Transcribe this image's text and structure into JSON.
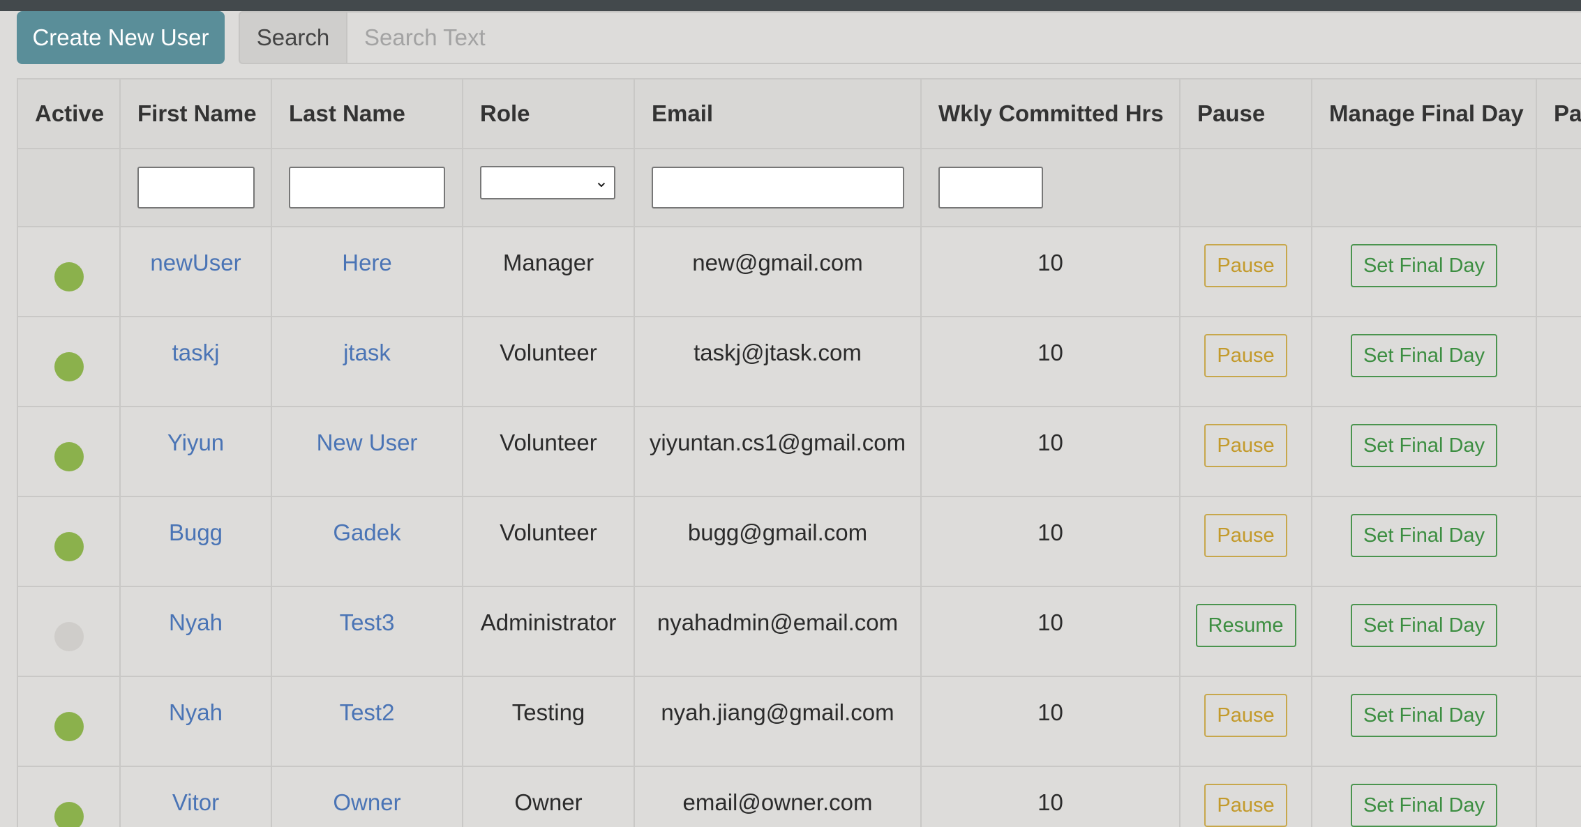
{
  "toolbar": {
    "create_label": "Create New User",
    "search_label": "Search",
    "search_placeholder": "Search Text"
  },
  "colors": {
    "active": "#8bb14c",
    "inactive": "#cfcdca",
    "create_button": "#5a8e99",
    "pause_text": "#c39a2b",
    "success_text": "#3c8e41",
    "link": "#4a74b5"
  },
  "columns": [
    "Active",
    "First Name",
    "Last Name",
    "Role",
    "Email",
    "Wkly Committed Hrs",
    "Pause",
    "Manage Final Day",
    "Pa"
  ],
  "rows": [
    {
      "active": true,
      "first": "newUser",
      "last": "Here",
      "role": "Manager",
      "email": "new@gmail.com",
      "hrs": "10",
      "pause": "Pause",
      "final": "Set Final Day"
    },
    {
      "active": true,
      "first": "taskj",
      "last": "jtask",
      "role": "Volunteer",
      "email": "taskj@jtask.com",
      "hrs": "10",
      "pause": "Pause",
      "final": "Set Final Day"
    },
    {
      "active": true,
      "first": "Yiyun",
      "last": "New User",
      "role": "Volunteer",
      "email": "yiyuntan.cs1@gmail.com",
      "hrs": "10",
      "pause": "Pause",
      "final": "Set Final Day"
    },
    {
      "active": true,
      "first": "Bugg",
      "last": "Gadek",
      "role": "Volunteer",
      "email": "bugg@gmail.com",
      "hrs": "10",
      "pause": "Pause",
      "final": "Set Final Day"
    },
    {
      "active": false,
      "first": "Nyah",
      "last": "Test3",
      "role": "Administrator",
      "email": "nyahadmin@email.com",
      "hrs": "10",
      "pause": "Resume",
      "final": "Set Final Day"
    },
    {
      "active": true,
      "first": "Nyah",
      "last": "Test2",
      "role": "Testing",
      "email": "nyah.jiang@gmail.com",
      "hrs": "10",
      "pause": "Pause",
      "final": "Set Final Day"
    },
    {
      "active": true,
      "first": "Vitor",
      "last": "Owner",
      "role": "Owner",
      "email": "email@owner.com",
      "hrs": "10",
      "pause": "Pause",
      "final": "Set Final Day"
    }
  ]
}
